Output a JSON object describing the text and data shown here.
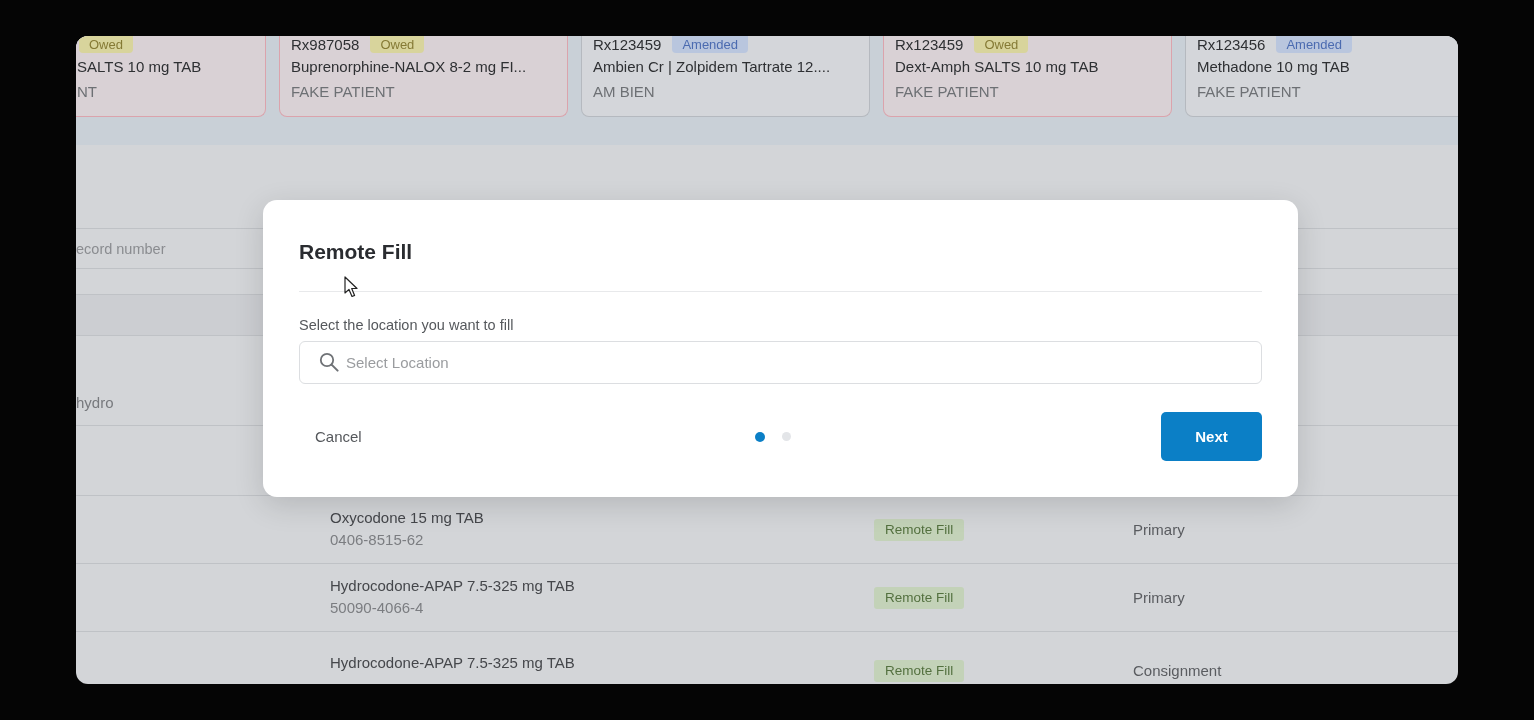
{
  "rx_cards": [
    {
      "kind": "owed",
      "status": "Owed",
      "drug": "SALTS 10 mg TAB",
      "patient": "NT"
    },
    {
      "kind": "owed",
      "rx": "Rx987058",
      "status": "Owed",
      "drug": "Buprenorphine-NALOX 8-2 mg FI...",
      "patient": "FAKE PATIENT"
    },
    {
      "kind": "amended",
      "rx": "Rx123459",
      "status": "Amended",
      "drug": "Ambien Cr | Zolpidem Tartrate 12....",
      "patient": "AM BIEN"
    },
    {
      "kind": "owed",
      "rx": "Rx123459",
      "status": "Owed",
      "drug": "Dext-Amph SALTS 10 mg TAB",
      "patient": "FAKE PATIENT"
    },
    {
      "kind": "amended",
      "rx": "Rx123456",
      "status": "Amended",
      "drug": "Methadone 10 mg TAB",
      "patient": "FAKE PATIENT"
    }
  ],
  "table": {
    "columns": [
      {
        "label": "ecord number"
      }
    ],
    "rows": [
      {
        "column_1": "hydro"
      },
      {
        "drug": "Oxycodone 15 mg TAB",
        "ndc": "0406-8515-62",
        "fill_type": "Remote Fill",
        "location": "Primary"
      },
      {
        "drug": "Hydrocodone-APAP 7.5-325 mg TAB",
        "ndc": "50090-4066-4",
        "fill_type": "Remote Fill",
        "location": "Primary"
      },
      {
        "drug": "Hydrocodone-APAP 7.5-325 mg TAB",
        "fill_type": "Remote Fill",
        "location": "Consignment"
      }
    ]
  },
  "modal": {
    "title": "Remote Fill",
    "label": "Select the location you want to fill",
    "search": {
      "placeholder": "Select Location"
    },
    "cancel": "Cancel",
    "steps": [
      {
        "selected": true
      },
      {
        "selected": false
      }
    ],
    "next": "Next"
  }
}
